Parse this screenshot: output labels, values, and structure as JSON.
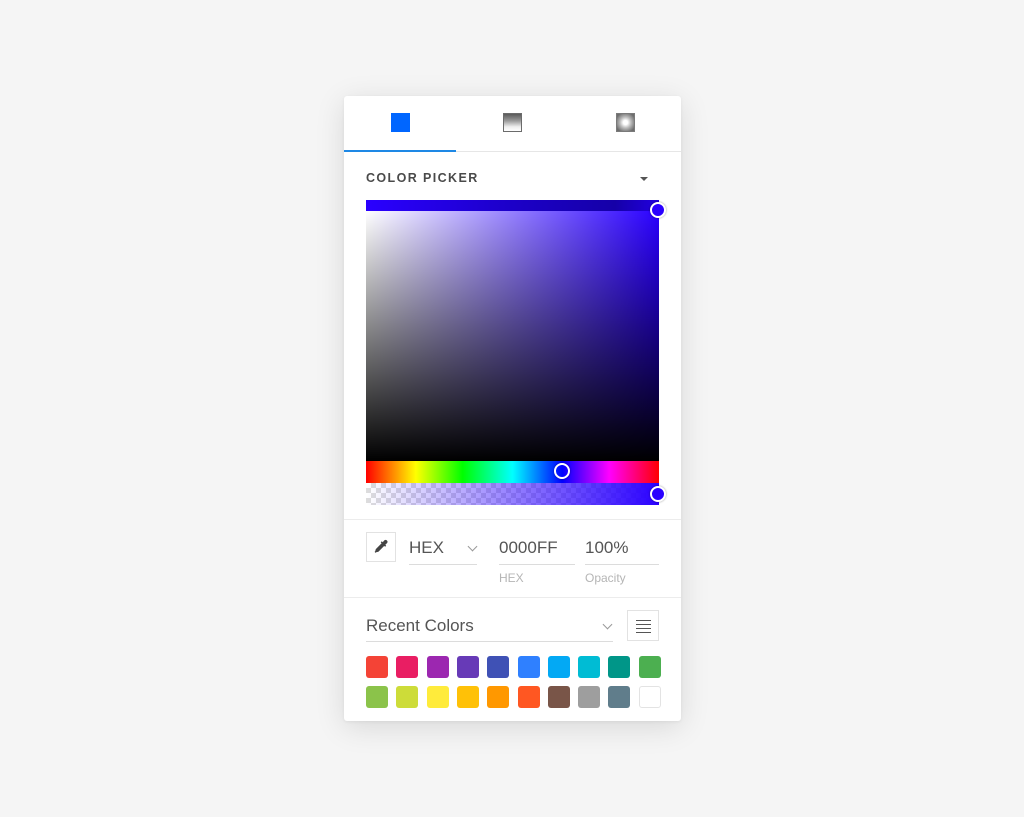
{
  "tabs": [
    {
      "name": "solid",
      "icon": "solid-fill-icon",
      "active": true
    },
    {
      "name": "linear-gradient",
      "icon": "linear-gradient-icon",
      "active": false
    },
    {
      "name": "radial-gradient",
      "icon": "radial-gradient-icon",
      "active": false
    }
  ],
  "picker": {
    "title": "COLOR PICKER",
    "selected_color": "#0000FF",
    "hue_position": 0.67,
    "saturation": 1.0,
    "value": 1.0,
    "alpha": 1.0
  },
  "inputs": {
    "format_select": "HEX",
    "hex_value": "0000FF",
    "hex_label": "HEX",
    "opacity_value": "100%",
    "opacity_label": "Opacity"
  },
  "recent": {
    "label": "Recent Colors",
    "swatches": [
      "#F44336",
      "#E91E63",
      "#9C27B0",
      "#673AB7",
      "#3F51B5",
      "#2F80FF",
      "#03A9F4",
      "#00BCD4",
      "#009688",
      "#4CAF50",
      "#8BC34A",
      "#CDDC39",
      "#FFEB3B",
      "#FFC107",
      "#FF9800",
      "#FF5722",
      "#795548",
      "#9E9E9E",
      "#607D8B",
      "#FFFFFF"
    ]
  },
  "colors": {
    "accent": "#1E88E5",
    "active_tab_icon": "#0066FF"
  }
}
